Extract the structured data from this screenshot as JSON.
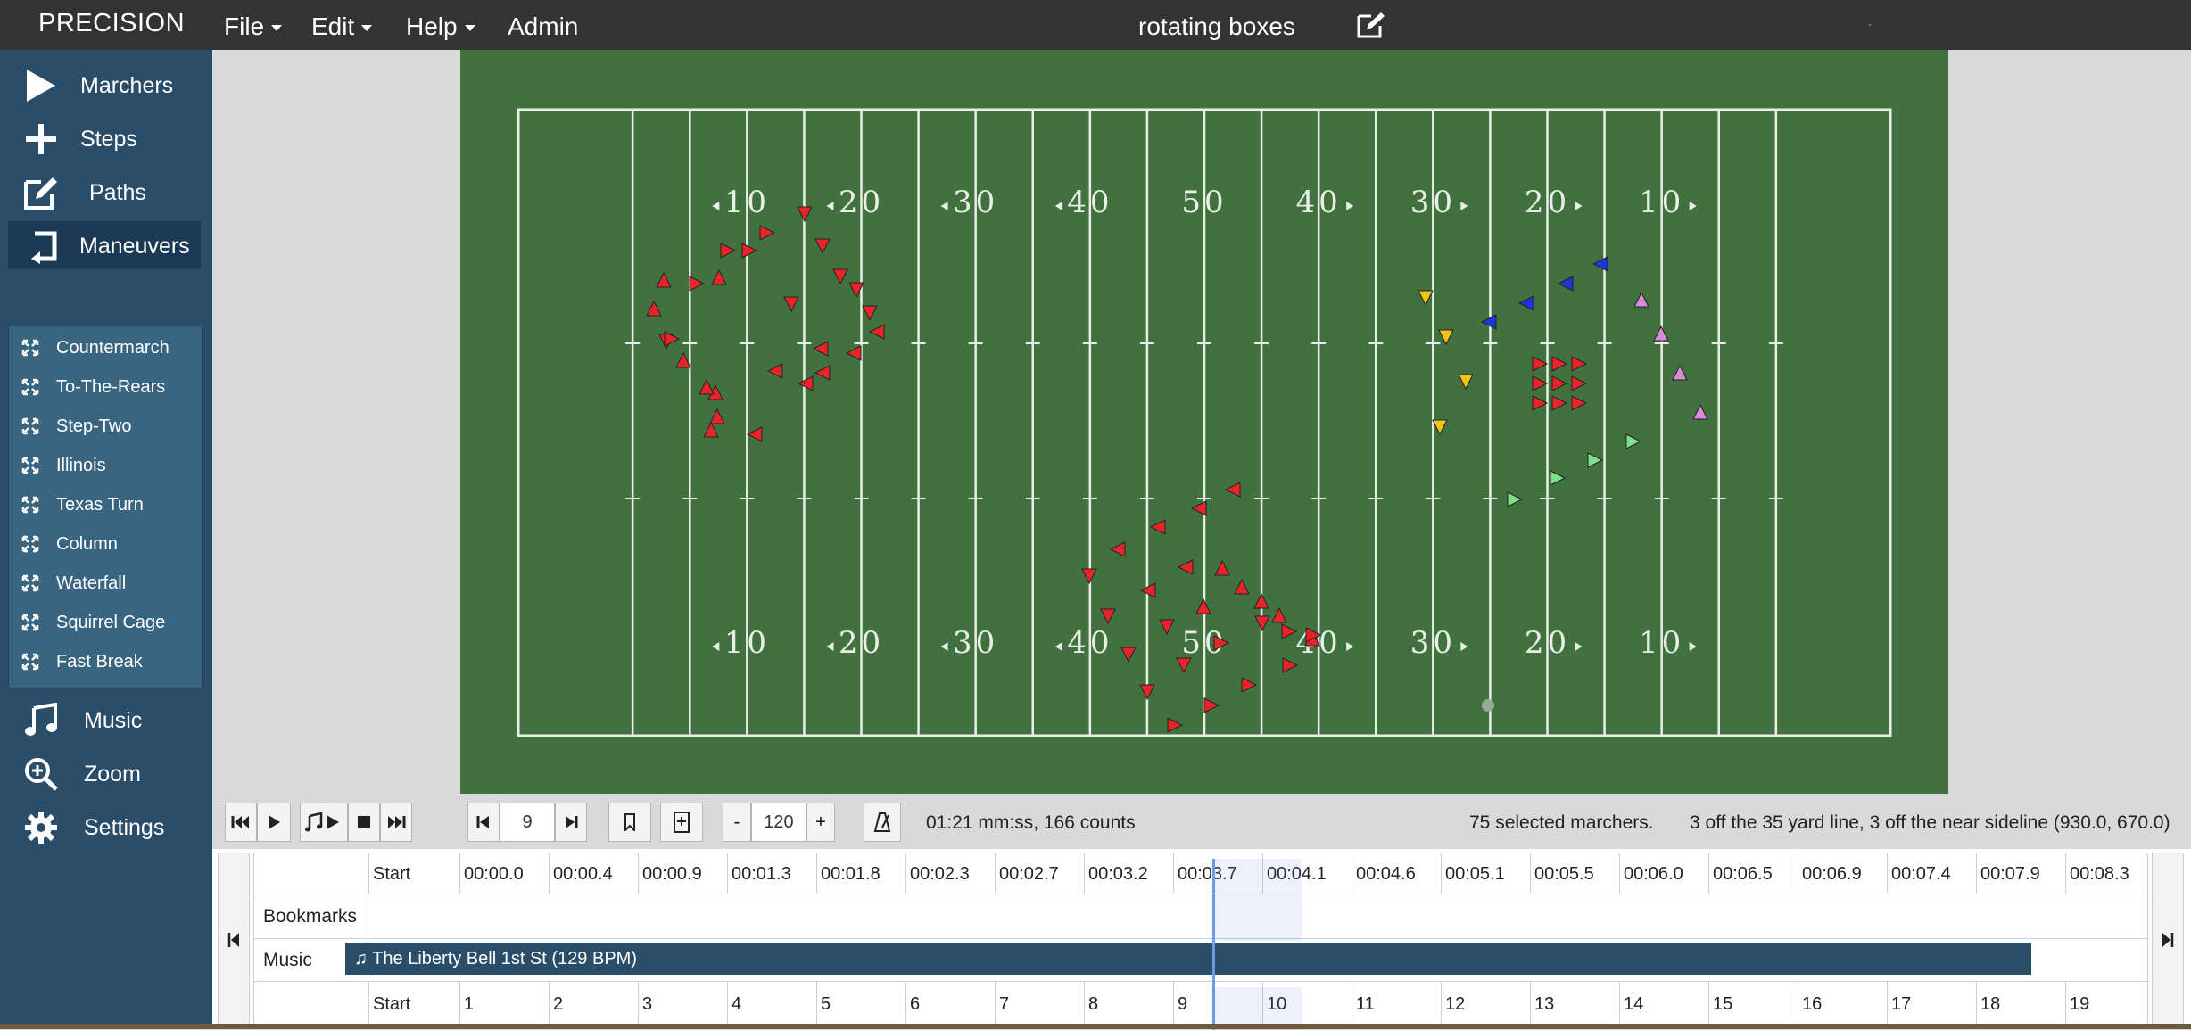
{
  "app": {
    "brand": "PRECISION",
    "menus": [
      "File",
      "Edit",
      "Help"
    ],
    "admin": "Admin",
    "document_title": "rotating boxes"
  },
  "sidebar": {
    "items": [
      {
        "label": "Marchers",
        "icon": "play-icon"
      },
      {
        "label": "Steps",
        "icon": "plus-icon"
      },
      {
        "label": "Paths",
        "icon": "edit-icon"
      },
      {
        "label": "Maneuvers",
        "icon": "turn-icon"
      },
      {
        "label": "Music",
        "icon": "music-icon"
      },
      {
        "label": "Zoom",
        "icon": "zoom-icon"
      },
      {
        "label": "Settings",
        "icon": "gear-icon"
      }
    ],
    "maneuvers": [
      "Countermarch",
      "To-The-Rears",
      "Step-Two",
      "Illinois",
      "Texas Turn",
      "Column",
      "Waterfall",
      "Squirrel Cage",
      "Fast Break"
    ]
  },
  "field": {
    "yard_labels_top": [
      "10",
      "20",
      "30",
      "40",
      "50",
      "40",
      "30",
      "20",
      "10"
    ],
    "yard_labels_bottom": [
      "10",
      "20",
      "30",
      "40",
      "50",
      "40",
      "30",
      "20",
      "10"
    ],
    "colors": {
      "turf": "#427140",
      "lines": "#e8efe6",
      "red": "#e8242b",
      "blue": "#1f35d6",
      "yellow": "#f2c21a",
      "pink": "#d78ad6",
      "green": "#7ee08a"
    }
  },
  "transport": {
    "count_value": "9",
    "tempo_value": "120",
    "minus": "-",
    "plus": "+",
    "duration": "01:21 mm:ss, 166 counts",
    "selection": "75 selected marchers.",
    "position": "3 off the 35 yard line, 3 off the near sideline (930.0, 670.0)"
  },
  "timeline": {
    "start_label": "Start",
    "time_ticks": [
      "00:00.0",
      "00:00.4",
      "00:00.9",
      "00:01.3",
      "00:01.8",
      "00:02.3",
      "00:02.7",
      "00:03.2",
      "00:03.7",
      "00:04.1",
      "00:04.6",
      "00:05.1",
      "00:05.5",
      "00:06.0",
      "00:06.5",
      "00:06.9",
      "00:07.4",
      "00:07.9",
      "00:08.3"
    ],
    "rows": {
      "bookmarks": "Bookmarks",
      "music": "Music"
    },
    "music_track": "The Liberty Bell 1st St (129 BPM)",
    "counts_start": "Start",
    "counts": [
      "1",
      "2",
      "3",
      "4",
      "5",
      "6",
      "7",
      "8",
      "9",
      "10",
      "11",
      "12",
      "13",
      "14",
      "15",
      "16",
      "17",
      "18",
      "19"
    ]
  }
}
